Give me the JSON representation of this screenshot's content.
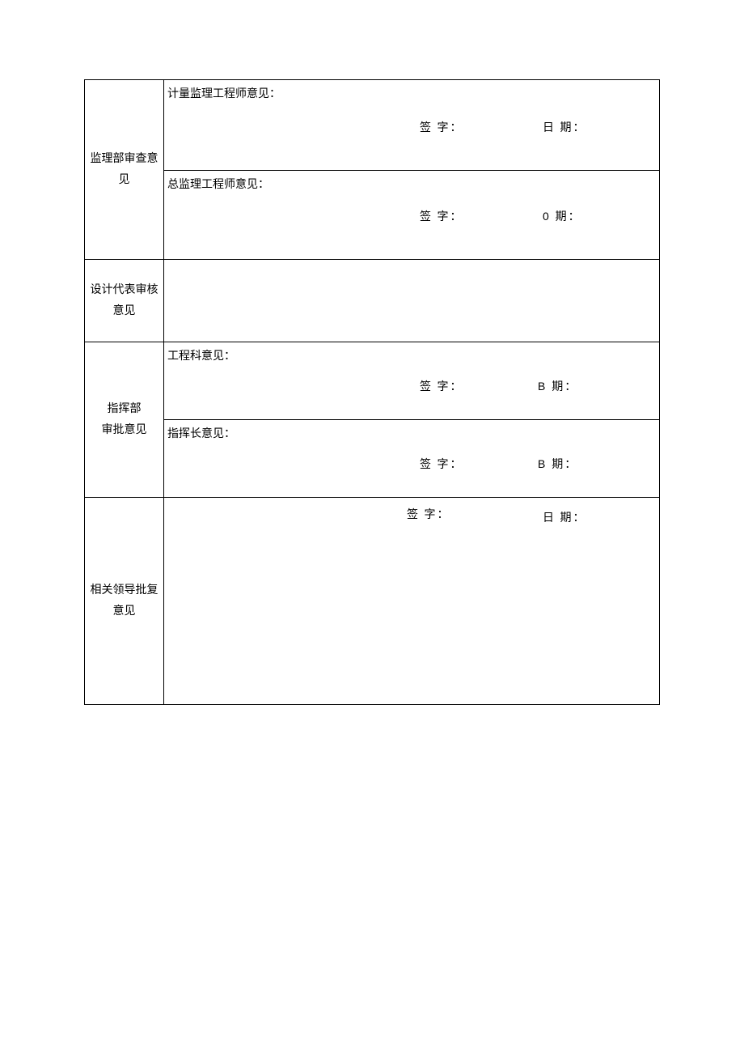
{
  "rows": {
    "supervision": {
      "label": "监理部审查意见",
      "measurement": {
        "title": "计量监理工程师意见：",
        "sign": "签  字：",
        "date": "日  期："
      },
      "chief": {
        "title": "总监理工程师意见：",
        "sign": "签 字：",
        "date": "0  期："
      }
    },
    "design": {
      "label": "设计代表审核意见"
    },
    "command": {
      "label_line1": "指挥部",
      "label_line2": "审批意见",
      "engineering": {
        "title": "工程科意见：",
        "sign": "签 字：",
        "date": "B  期："
      },
      "commander": {
        "title": "指挥长意见：",
        "sign": "签 字：",
        "date": "B  期："
      }
    },
    "leadership": {
      "label": "相关领导批复意见",
      "sign": "签  字：",
      "date": "日  期："
    }
  }
}
